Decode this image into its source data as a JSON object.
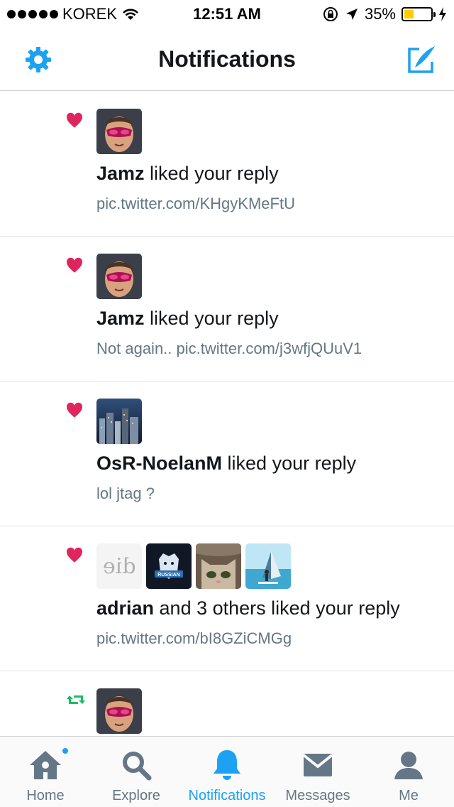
{
  "status": {
    "carrier": "KOREK",
    "time": "12:51 AM",
    "battery": "35%",
    "battery_level": 0.35
  },
  "nav": {
    "title": "Notifications"
  },
  "notifications": [
    {
      "type": "like",
      "icon": "heart-icon",
      "actor": "Jamz",
      "action": " liked your reply",
      "sub": " pic.twitter.com/KHgyKMeFtU"
    },
    {
      "type": "like",
      "icon": "heart-icon",
      "actor": "Jamz",
      "action": " liked your reply",
      "sub": "Not again.. pic.twitter.com/j3wfjQUuV1"
    },
    {
      "type": "like",
      "icon": "heart-icon",
      "actor": "OsR-NoelanM",
      "action": " liked your reply",
      "sub": "lol jtag ?"
    },
    {
      "type": "like",
      "icon": "heart-icon",
      "actor": "adrian",
      "action": " and 3 others liked your reply",
      "sub": " pic.twitter.com/bI8GZiCMGg",
      "avatar_text": "die",
      "avatar_badge": "RUSSIAN"
    },
    {
      "type": "retweet",
      "icon": "retweet-icon"
    }
  ],
  "tabs": [
    {
      "label": "Home",
      "icon": "home-icon",
      "active": false,
      "has_dot": true
    },
    {
      "label": "Explore",
      "icon": "search-icon",
      "active": false
    },
    {
      "label": "Notifications",
      "icon": "bell-icon",
      "active": true
    },
    {
      "label": "Messages",
      "icon": "envelope-icon",
      "active": false
    },
    {
      "label": "Me",
      "icon": "person-icon",
      "active": false
    }
  ],
  "colors": {
    "accent": "#1da1f2",
    "heart": "#e0245e",
    "retweet": "#17bf63",
    "muted": "#657786"
  }
}
